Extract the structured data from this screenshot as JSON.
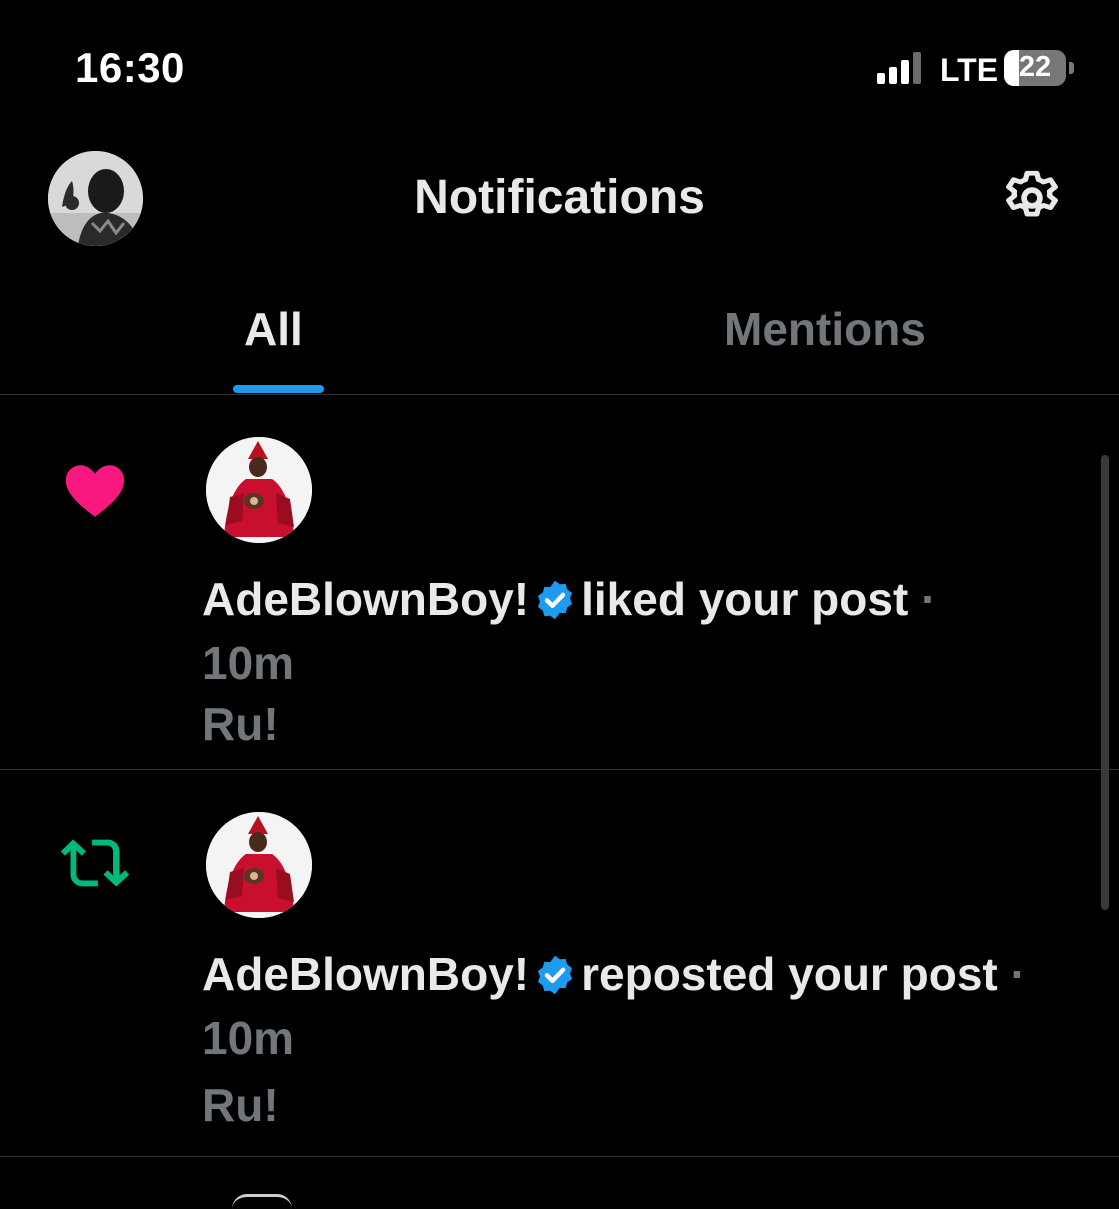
{
  "status_bar": {
    "time": "16:30",
    "network": "LTE",
    "battery_level": "22",
    "signal_bars_active": 3,
    "signal_bars_total": 4
  },
  "header": {
    "title": "Notifications",
    "settings_icon": "gear-icon"
  },
  "tabs": [
    {
      "label": "All",
      "selected": true
    },
    {
      "label": "Mentions",
      "selected": false
    }
  ],
  "notifications": [
    {
      "type": "like",
      "icon": "heart-icon",
      "user": "AdeBlownBoy!",
      "verified": true,
      "action": "liked your post",
      "separator": "·",
      "time": "10m",
      "preview": "Ru!"
    },
    {
      "type": "repost",
      "icon": "repost-icon",
      "user": "AdeBlownBoy!",
      "verified": true,
      "action": "reposted your post",
      "separator": "·",
      "time": "10m",
      "preview": "Ru!"
    }
  ],
  "colors": {
    "background": "#000000",
    "text_primary": "#e7e9ea",
    "text_secondary": "#71767b",
    "accent": "#1d9bf0",
    "like": "#f91880",
    "repost": "#00ba7c",
    "divider": "#2f3336"
  }
}
